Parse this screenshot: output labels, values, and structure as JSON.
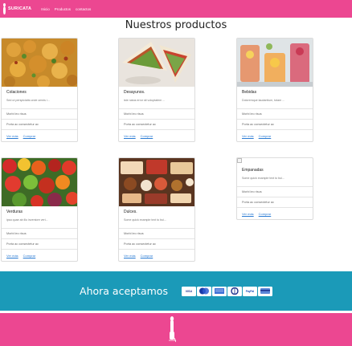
{
  "nav": {
    "brand": "SURICATA",
    "links": [
      "Inicio",
      "Productos",
      "contactos"
    ]
  },
  "main": {
    "title": "Nuestros productos"
  },
  "products": [
    {
      "title": "Colaciones",
      "text": "Sed ut perspiciatis unde omnis i...",
      "items": [
        "Morbi leo risus",
        "Porta ac consectetur ac"
      ],
      "links": [
        "Ver más",
        "Comprar"
      ],
      "image": "food-platter"
    },
    {
      "title": "Desayunos.",
      "text": "iste natus error sit voluptatem ...",
      "items": [
        "Morbi leo risus",
        "Porta ac consectetur ac"
      ],
      "links": [
        "Ver más",
        "Comprar"
      ],
      "image": "sandwich"
    },
    {
      "title": "Bebidas",
      "text": "Doloremque laudantium, totam ...",
      "items": [
        "Morbi leo risus",
        "Porta ac consectetur ac"
      ],
      "links": [
        "Ver más",
        "Comprar"
      ],
      "image": "drinks"
    },
    {
      "title": "Verduras",
      "text": "ipsa quae ab illo inventore veri...",
      "items": [
        "Morbi leo risus",
        "Porta ac consectetur ac"
      ],
      "links": [
        "Ver más",
        "Comprar"
      ],
      "image": "vegetables"
    },
    {
      "title": "Dulces.",
      "text": "Some quick example text to bui...",
      "items": [
        "Morbi leo risus",
        "Porta ac consectetur ac"
      ],
      "links": [
        "Ver más",
        "Comprar"
      ],
      "image": "sweets"
    },
    {
      "title": "Empanadas",
      "text": "Some quick example text to bui...",
      "items": [
        "Morbi leo risus",
        "Porta ac consectetur ac"
      ],
      "links": [
        "Ver más",
        "Comprar"
      ],
      "image": "broken-image"
    }
  ],
  "banner": {
    "text": "Ahora aceptamos",
    "payment_methods": [
      "VISA",
      "MC",
      "AMEX",
      "DC",
      "PayPal",
      "CARD"
    ]
  },
  "footer": {
    "logo": "meerkat-logo-icon"
  }
}
